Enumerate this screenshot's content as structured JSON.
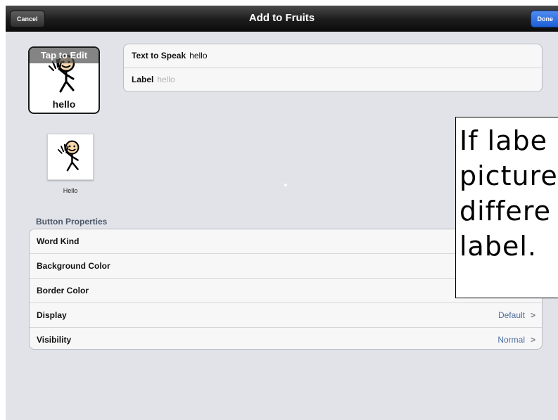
{
  "navbar": {
    "title": "Add to Fruits",
    "cancel_label": "Cancel",
    "done_label": "Done"
  },
  "button_editor": {
    "tap_to_edit": "Tap to Edit",
    "preview_label": "hello",
    "preview_icon": "waving-person-icon"
  },
  "text_fields": {
    "text_to_speak_label": "Text to Speak",
    "text_to_speak_value": "hello",
    "label_label": "Label",
    "label_value": "hello"
  },
  "symbol_results": [
    {
      "caption": "Hello",
      "icon": "waving-person-icon"
    }
  ],
  "button_properties": {
    "header": "Button Properties",
    "rows": [
      {
        "label": "Word Kind",
        "value": ""
      },
      {
        "label": "Background Color",
        "value": ""
      },
      {
        "label": "Border Color",
        "value": ""
      },
      {
        "label": "Display",
        "value": "Default"
      },
      {
        "label": "Visibility",
        "value": "Normal"
      }
    ]
  },
  "callout": {
    "text": "If labe\npicture\ndiffere\nlabel."
  },
  "colors": {
    "navbar": "#1c1c1c",
    "done_button": "#2b6ee3",
    "background": "#e1e3e8",
    "section_header": "#4c566a",
    "value_text": "#4f6f9f"
  }
}
